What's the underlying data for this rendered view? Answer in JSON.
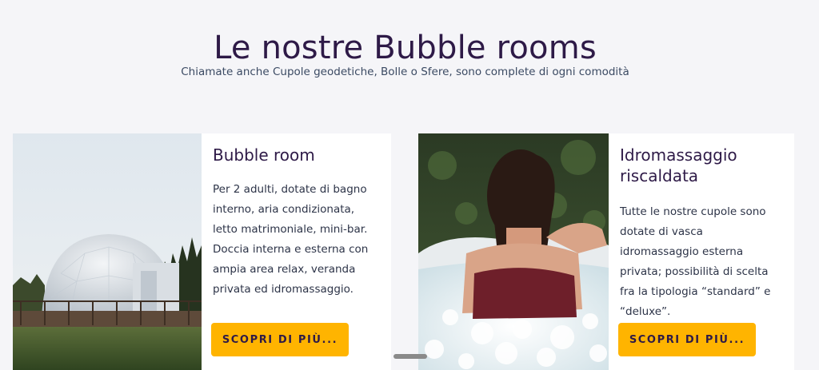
{
  "header": {
    "title": "Le nostre Bubble rooms",
    "subtitle": "Chiamate anche Cupole geodetiche, Bolle o Sfere, sono complete di ogni comodità"
  },
  "cards": [
    {
      "title": "Bubble room",
      "text": "Per 2 adulti, dotate di bagno interno, aria condizionata, letto matrimoniale, mini-bar. Doccia interna e esterna con ampia area relax, veranda privata ed idromassaggio.",
      "button_label": "SCOPRI DI PIÙ...",
      "image_name": "geodesic-dome-photo"
    },
    {
      "title": "Idromassaggio riscaldata",
      "text": "Tutte le nostre cupole sono dotate di vasca idromassaggio esterna privata; possibilità di scelta fra la tipologia “standard” e “deluxe”.",
      "button_label": "SCOPRI DI PIÙ...",
      "image_name": "hot-tub-photo"
    }
  ],
  "colors": {
    "background": "#f5f5f8",
    "heading": "#2e1a47",
    "button": "#ffb400",
    "card": "#ffffff"
  }
}
